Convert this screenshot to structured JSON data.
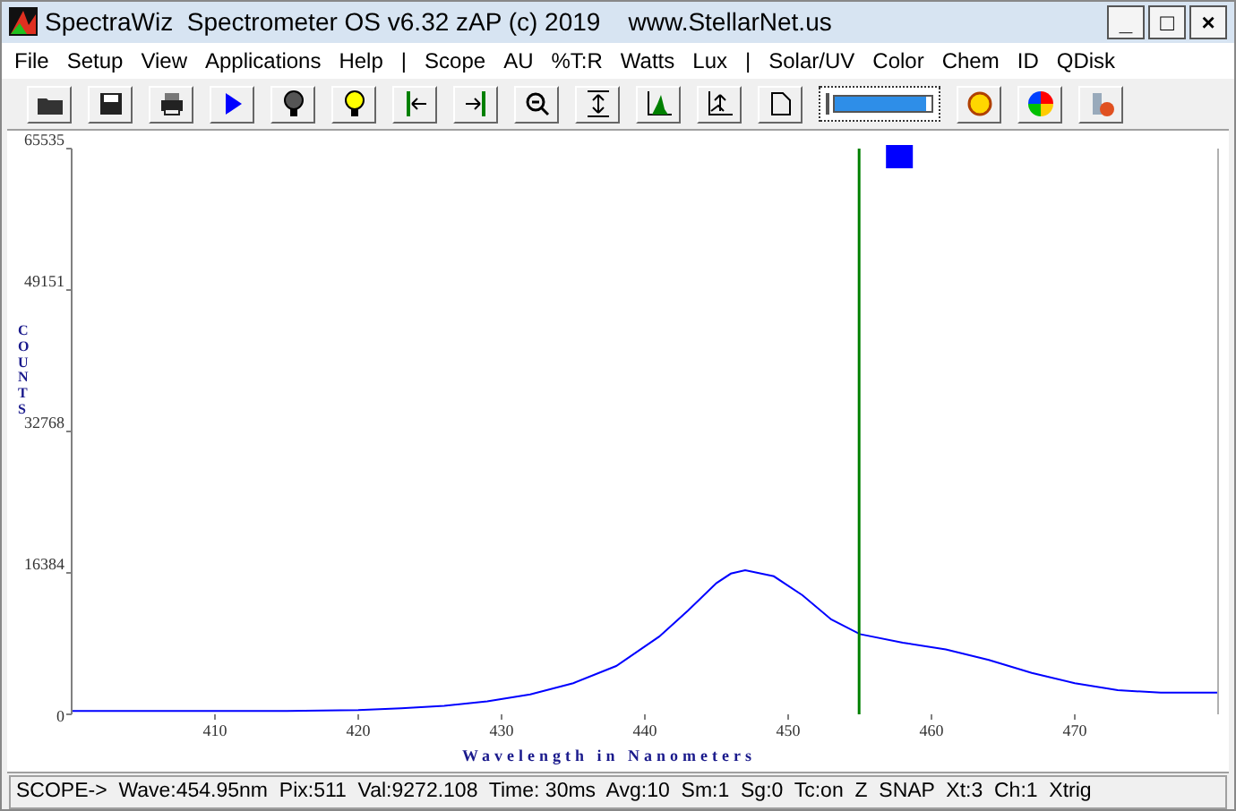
{
  "window": {
    "title": "SpectraWiz  Spectrometer OS v6.32 zAP (c) 2019    www.StellarNet.us",
    "controls": [
      "_",
      "□",
      "×"
    ]
  },
  "menu": [
    "File",
    "Setup",
    "View",
    "Applications",
    "Help",
    "|",
    "Scope",
    "AU",
    "%T:R",
    "Watts",
    "Lux",
    "|",
    "Solar/UV",
    "Color",
    "Chem",
    "ID",
    "QDisk"
  ],
  "toolbar": {
    "meter": {
      "level": 0.95
    }
  },
  "graph": {
    "chart_data": {
      "type": "line",
      "xlabel": "Wavelength in Nanometers",
      "ylabel": "COUNTS",
      "xlim": [
        400,
        480
      ],
      "ylim": [
        0,
        65535
      ],
      "xticks": [
        410,
        420,
        430,
        440,
        450,
        460,
        470
      ],
      "yticks": [
        0,
        16384,
        32768,
        49151,
        65535
      ],
      "x": [
        400,
        405,
        410,
        415,
        420,
        423,
        426,
        429,
        432,
        435,
        438,
        441,
        443,
        445,
        446,
        447,
        449,
        451,
        453,
        455,
        458,
        461,
        464,
        467,
        470,
        473,
        476,
        480
      ],
      "series": [
        {
          "color": "#0000ff",
          "values": [
            400,
            400,
            400,
            400,
            500,
            700,
            1000,
            1500,
            2300,
            3600,
            5600,
            9000,
            12000,
            15200,
            16300,
            16700,
            16000,
            13800,
            11000,
            9300,
            8300,
            7500,
            6300,
            4800,
            3600,
            2800,
            2500,
            2500
          ]
        }
      ],
      "ref_lines": [
        {
          "axis": "x",
          "value": 454.95,
          "color": "#008000"
        }
      ]
    }
  },
  "status": "SCOPE->  Wave:454.95nm  Pix:511  Val:9272.108  Time: 30ms  Avg:10  Sm:1  Sg:0  Tc:on  Z  SNAP  Xt:3  Ch:1  Xtrig"
}
